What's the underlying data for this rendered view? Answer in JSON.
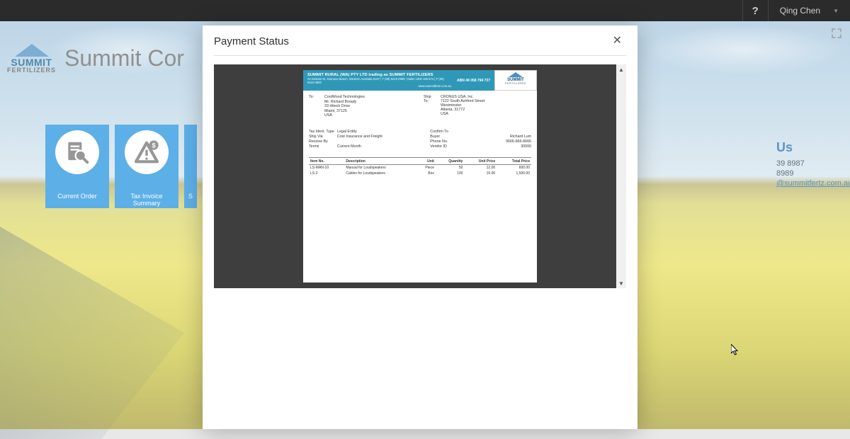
{
  "header": {
    "help_label": "?",
    "user_name": "Qing Chen"
  },
  "brand": {
    "logo_line1": "SUMMIT",
    "logo_line2": "FERTILIZERS",
    "page_title": "Summit Cor"
  },
  "tiles": {
    "current_order_label": "Current Order",
    "tax_invoice_label": "Tax Invoice Summary",
    "third_label": "S"
  },
  "contact": {
    "heading": "Us",
    "phone1": "39 8987",
    "phone2": "8989",
    "email": "@summitfertz.com.au"
  },
  "modal": {
    "title": "Payment Status"
  },
  "doc": {
    "banner": {
      "title": "SUMMIT RURAL (WA) PTY LTD trading as SUMMIT FERTILIZERS",
      "abn": "ABN 49 058 794 737",
      "sub": "24 Dostats St, Kwinana Beach, Western Australia 6167 | T (08) 9419 0999 | Sales 1800 186 674 | F (08) 9419 0900",
      "website": "www.summitfertz.com.au"
    },
    "logo": {
      "line1": "SUMMIT",
      "line2": "FERTILIZERS"
    },
    "to": {
      "label": "To:",
      "name": "CoolWood Technologies",
      "att": "Mr. Richard Bready",
      "street": "33 Hitech Drive",
      "citystate": "Miami, 37125",
      "country": "USA"
    },
    "ship": {
      "label1": "Ship",
      "label2": "To:",
      "name": "CRONUS USA, Inc.",
      "street": "7122 South Ashford Street",
      "city": "Westminster",
      "citystate": "Atlanta, 31772",
      "country": "USA"
    },
    "meta": {
      "left": {
        "tax_ident_type": {
          "l": "Tax Ident. Type",
          "v": "Legal Entity"
        },
        "ship_via": {
          "l": "Ship Via",
          "v": "Cost Insurance and Freight"
        },
        "receive_by": {
          "l": "Receive By",
          "v": ""
        },
        "terms": {
          "l": "Terms",
          "v": "Current Month"
        }
      },
      "right": {
        "confirm_to": {
          "l": "Confirm To",
          "v": ""
        },
        "buyer": {
          "l": "Buyer",
          "v": "Richard Lum"
        },
        "phone": {
          "l": "Phone No.",
          "v": "0666-666-6666"
        },
        "vendor": {
          "l": "Vendor ID",
          "v": "30000"
        }
      }
    },
    "table": {
      "headers": {
        "item": "Item No.",
        "desc": "Description",
        "unit": "Unit",
        "qty": "Quantity",
        "price": "Unit Price",
        "total": "Total Price"
      },
      "rows": [
        {
          "item": "LS-MAN-10",
          "desc": "Manual for Loudspeakers",
          "unit": "Piece",
          "qty": "50",
          "price": "12.00",
          "total": "600.00"
        },
        {
          "item": "LS-2",
          "desc": "Cables for Loudspeakers",
          "unit": "Box",
          "qty": "100",
          "price": "15.00",
          "total": "1,500.00"
        }
      ]
    }
  }
}
